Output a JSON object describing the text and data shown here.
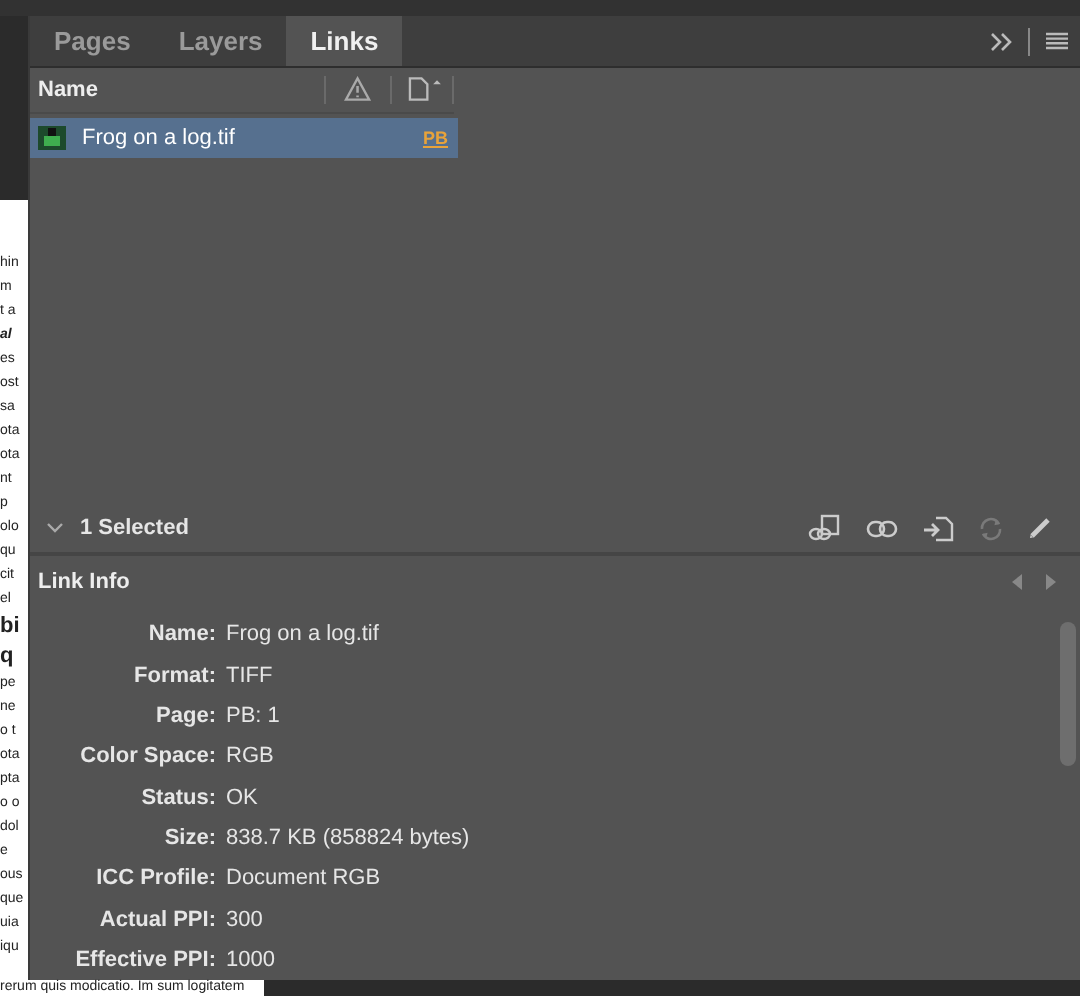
{
  "background_document": {
    "fragments": [
      {
        "text": "hin",
        "kind": "normal"
      },
      {
        "text": "m",
        "kind": "normal"
      },
      {
        "text": "t a",
        "kind": "normal"
      },
      {
        "text": "al",
        "kind": "italic"
      },
      {
        "text": "es",
        "kind": "normal"
      },
      {
        "text": "ost",
        "kind": "normal"
      },
      {
        "text": "sa",
        "kind": "normal"
      },
      {
        "text": "ota",
        "kind": "normal"
      },
      {
        "text": "ota",
        "kind": "normal"
      },
      {
        "text": "nt",
        "kind": "normal"
      },
      {
        "text": "p",
        "kind": "normal"
      },
      {
        "text": "olo",
        "kind": "normal"
      },
      {
        "text": "qu",
        "kind": "normal"
      },
      {
        "text": "cit",
        "kind": "normal"
      },
      {
        "text": "el",
        "kind": "normal"
      },
      {
        "text": "bi",
        "kind": "heading"
      },
      {
        "text": "q",
        "kind": "heading"
      },
      {
        "text": "pe",
        "kind": "normal"
      },
      {
        "text": "ne",
        "kind": "normal"
      },
      {
        "text": "o t",
        "kind": "normal"
      },
      {
        "text": "ota",
        "kind": "normal"
      },
      {
        "text": "pta",
        "kind": "normal"
      },
      {
        "text": "o o",
        "kind": "normal"
      },
      {
        "text": "dol",
        "kind": "normal"
      },
      {
        "text": "e",
        "kind": "normal"
      },
      {
        "text": "ous",
        "kind": "normal"
      },
      {
        "text": "que",
        "kind": "normal"
      },
      {
        "text": "uia",
        "kind": "normal"
      },
      {
        "text": "iqu",
        "kind": "normal"
      }
    ],
    "bottom_line": "rerum quis modicatio. Im sum logitatem"
  },
  "tabs": [
    {
      "label": "Pages",
      "selected": false
    },
    {
      "label": "Layers",
      "selected": false
    },
    {
      "label": "Links",
      "selected": true
    }
  ],
  "links_table": {
    "column_name": "Name",
    "rows": [
      {
        "name": "Frog on a log.tif",
        "page": "PB",
        "selected": true
      }
    ]
  },
  "selection_summary": "1 Selected",
  "link_info": {
    "title": "Link Info",
    "fields": [
      {
        "label": "Name:",
        "value": "Frog on a log.tif"
      },
      {
        "label": "Format:",
        "value": "TIFF"
      },
      {
        "label": "Page:",
        "value": "PB: 1"
      },
      {
        "label": "Color Space:",
        "value": "RGB"
      },
      {
        "label": "Status:",
        "value": "OK"
      },
      {
        "label": "Size:",
        "value": "838.7 KB (858824 bytes)"
      },
      {
        "label": "ICC Profile:",
        "value": "Document RGB"
      },
      {
        "label": "Actual PPI:",
        "value": "300"
      },
      {
        "label": "Effective PPI:",
        "value": "1000"
      }
    ]
  }
}
